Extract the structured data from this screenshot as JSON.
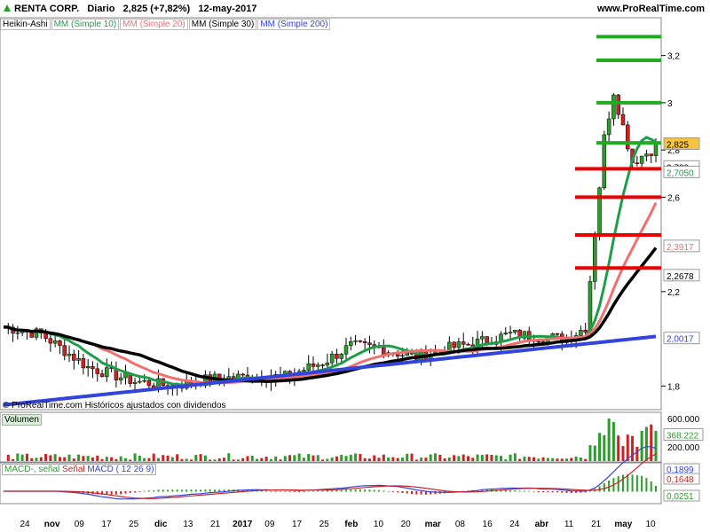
{
  "header": {
    "symbol": "RENTA CORP.",
    "period": "Diario",
    "price_change": "2,825 (+7,82%)",
    "date": "12-may-2017",
    "site": "www.ProRealTime.com"
  },
  "legend": {
    "heikin": "Heikin-Ashi",
    "mm10": "MM (Simple 10)",
    "mm20": "MM (Simple 20)",
    "mm30": "MM (Simple 30)",
    "mm200": "MM (Simple 200)"
  },
  "footnote": "© ProRealTime.com Históricos ajustados con dividendos",
  "colors": {
    "up": "#2a9d2a",
    "down": "#cc2222",
    "mm10": "#1f9e4a",
    "mm20": "#f07070",
    "mm30": "#000000",
    "mm200": "#3344dd",
    "support": "#ee0000",
    "resistance": "#22aa22"
  },
  "chart_data": [
    {
      "type": "candlestick",
      "title": "RENTA CORP. Diario",
      "ylim": [
        1.7,
        3.3
      ],
      "y_ticks": [
        "3,2",
        "3",
        "2,8",
        "2,6",
        "2,2",
        "1,8"
      ],
      "x_ticks": [
        "24",
        "nov",
        "09",
        "17",
        "25",
        "dic",
        "13",
        "21",
        "2017",
        "09",
        "17",
        "25",
        "feb",
        "10",
        "20",
        "mar",
        "08",
        "16",
        "24",
        "abr",
        "11",
        "21",
        "may",
        "10"
      ],
      "price_labels": {
        "last": "2,825",
        "r1": "2,728",
        "mm10": "2,7050",
        "mm20": "2,3917",
        "mm30": "2,2678",
        "mm200": "2,0017"
      },
      "red_lines": [
        2.72,
        2.6,
        2.44,
        2.3
      ],
      "green_lines": [
        3.28,
        3.18,
        3.0,
        2.83
      ],
      "series": [
        {
          "name": "MM (Simple 10)"
        },
        {
          "name": "MM (Simple 20)"
        },
        {
          "name": "MM (Simple 30)"
        },
        {
          "name": "MM (Simple 200)"
        }
      ]
    },
    {
      "type": "bar",
      "title": "Volumen",
      "ylim": [
        0,
        650000
      ],
      "y_ticks": [
        "600.000",
        "200.000"
      ],
      "last_value": "368.222"
    },
    {
      "type": "line",
      "title": "MACD",
      "legend": [
        "MACD-, señal",
        "Señal",
        "MACD ( 12 26 9)"
      ],
      "value_labels": [
        "0,1899",
        "0,1648",
        "0,0251"
      ]
    }
  ]
}
